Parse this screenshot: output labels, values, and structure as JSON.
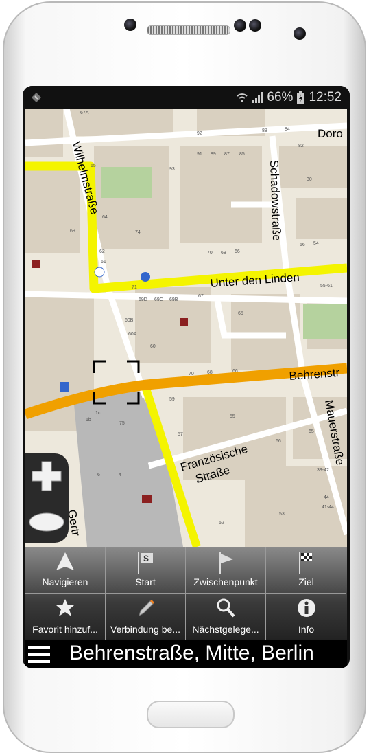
{
  "status_bar": {
    "battery": "66%",
    "time": "12:52",
    "icons": [
      "app-notification-icon",
      "wifi-icon",
      "signal-icon",
      "battery-charging-icon"
    ]
  },
  "map": {
    "streets": [
      "Wilhelmstraße",
      "Schadowstraße",
      "Doro",
      "Unter den Linden",
      "Behrenstr",
      "Französische",
      "Straße",
      "Mauerstraße",
      "ße",
      "Gertr"
    ],
    "house_numbers": [
      "67A",
      "92",
      "88",
      "84",
      "82",
      "65",
      "93",
      "91",
      "89",
      "87",
      "85",
      "64",
      "74",
      "69",
      "62",
      "70",
      "68",
      "66",
      "56",
      "54",
      "61",
      "71",
      "69D",
      "69C",
      "69B",
      "67",
      "55-61",
      "60B",
      "65",
      "60A",
      "60",
      "70",
      "68",
      "66",
      "59",
      "57",
      "55",
      "1c",
      "1b",
      "75",
      "66",
      "65",
      "6",
      "4",
      "39-42",
      "44",
      "41-44",
      "53",
      "52",
      "2",
      "1",
      "30"
    ],
    "colors": {
      "primary_road": "#f4f400",
      "secondary_road": "#f0a000",
      "background": "#ede8dc",
      "building": "#d9d0c0"
    }
  },
  "menu": {
    "items": [
      {
        "label": "Navigieren",
        "icon": "navigate-arrow-icon"
      },
      {
        "label": "Start",
        "icon": "start-flag-icon"
      },
      {
        "label": "Zwischenpunkt",
        "icon": "waypoint-flag-icon"
      },
      {
        "label": "Ziel",
        "icon": "finish-flag-icon"
      },
      {
        "label": "Favorit hinzuf...",
        "icon": "star-icon"
      },
      {
        "label": "Verbindung be...",
        "icon": "pencil-icon"
      },
      {
        "label": "Nächstgelege...",
        "icon": "search-icon"
      },
      {
        "label": "Info",
        "icon": "info-icon"
      }
    ]
  },
  "bottom_bar": {
    "title": "Behrenstraße, Mitte, Berlin"
  }
}
